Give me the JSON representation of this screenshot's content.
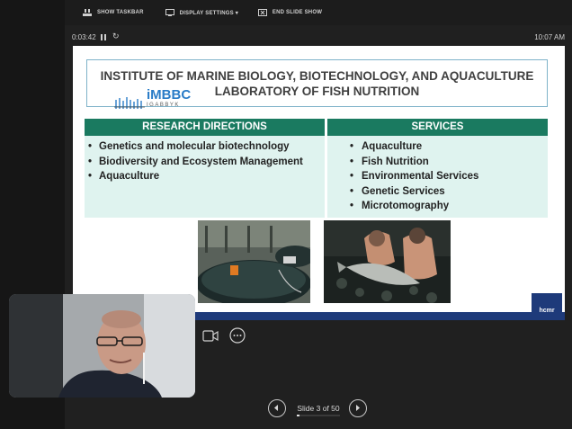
{
  "toolbar": {
    "show_taskbar": "SHOW TASKBAR",
    "display_settings": "DISPLAY SETTINGS ▾",
    "end_slide_show": "END SLIDE SHOW"
  },
  "status": {
    "timer": "0:03:42",
    "clock": "10:07 AM"
  },
  "slide": {
    "title_line1": "INSTITUTE OF MARINE BIOLOGY, BIOTECHNOLOGY, AND AQUACULTURE",
    "title_line2": "LABORATORY OF FISH NUTRITION",
    "logo_text": "iMBBC",
    "logo_sub": "IGABBYK",
    "research": {
      "heading": "RESEARCH DIRECTIONS",
      "items": [
        "Genetics and molecular biotechnology",
        "Biodiversity and Ecosystem Management",
        "Aquaculture"
      ]
    },
    "services": {
      "heading": "SERVICES",
      "items": [
        "Aquaculture",
        "Fish Nutrition",
        "Environmental Services",
        "Genetic Services",
        "Microtomography"
      ]
    },
    "footer_logo": "hcmr"
  },
  "navigation": {
    "slide_count": "Slide 3 of 50",
    "progress": 0.06
  },
  "colors": {
    "accent_green": "#1a7a60",
    "panel_mint": "#dff3ef",
    "footer_navy": "#1e3a7a",
    "logo_blue": "#2a7cc7"
  }
}
